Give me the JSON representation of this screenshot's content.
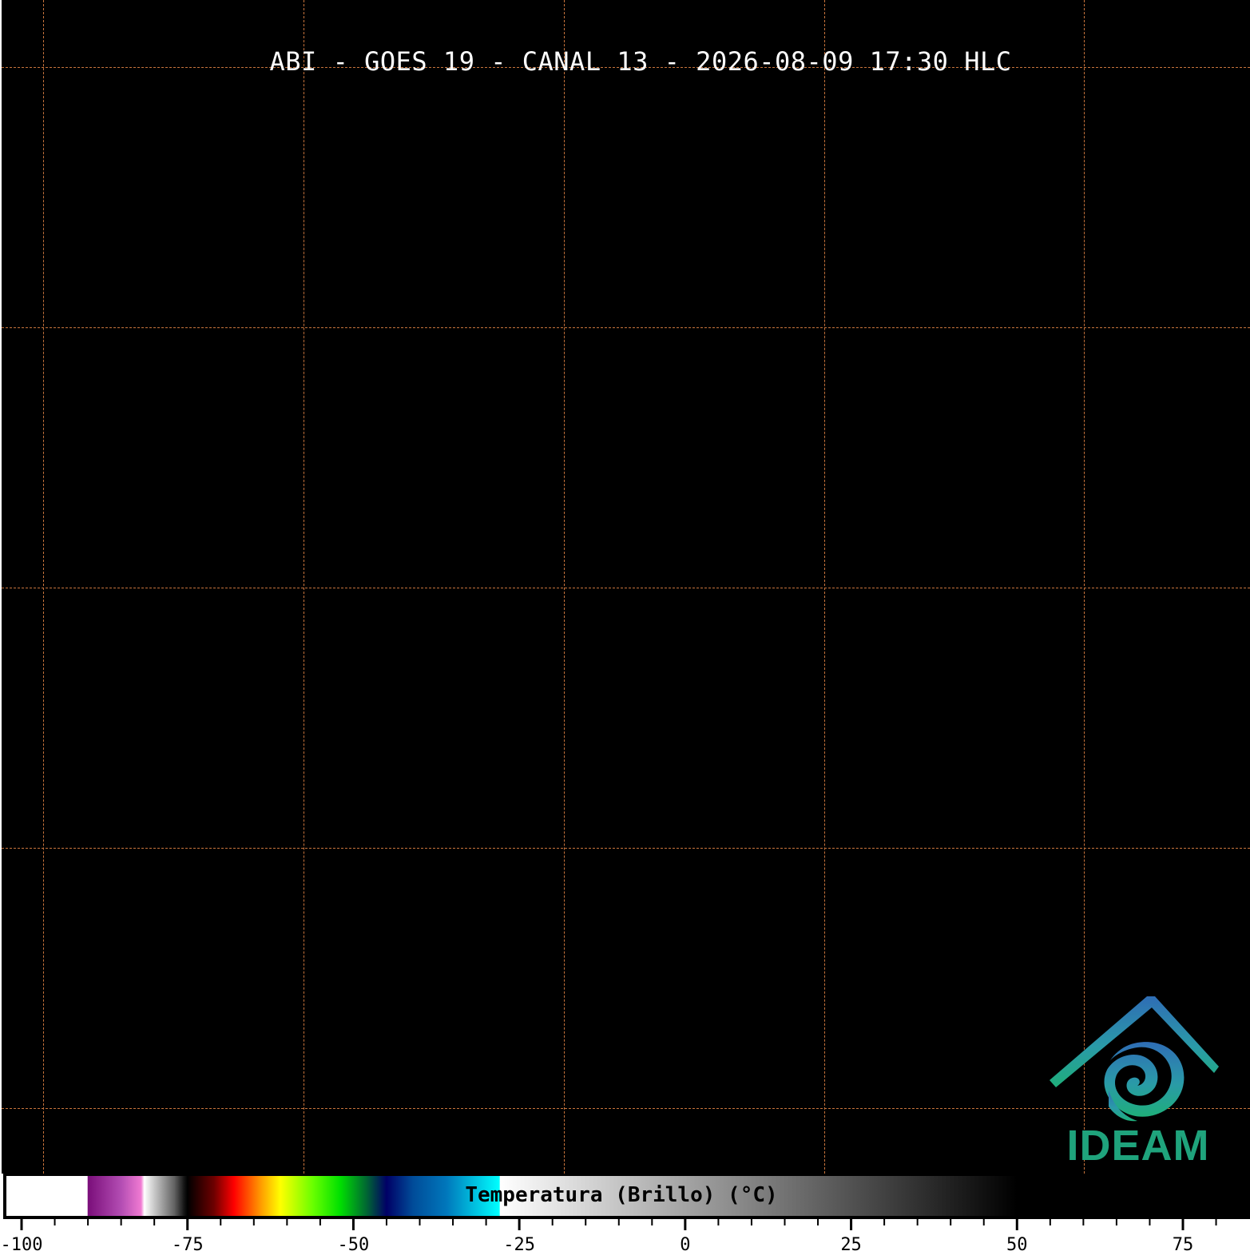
{
  "title": "ABI - GOES 19 - CANAL 13 - 2026-08-09 17:30 HLC",
  "logo": {
    "text": "IDEAM",
    "icon": "ideam-swirl-logo",
    "color": "#1fa37c"
  },
  "grid_color": "#c8743c",
  "colorbar": {
    "label": "Temperatura (Brillo) (°C)",
    "range": [
      -100,
      80
    ],
    "major_ticks": [
      -100,
      -75,
      -50,
      -25,
      0,
      25,
      50,
      75
    ],
    "minor_step": 5,
    "tick_labels": [
      "-100",
      "-75",
      "-50",
      "-25",
      "0",
      "25",
      "50",
      "75"
    ],
    "stops": [
      {
        "v": -100,
        "c": "#ffffff"
      },
      {
        "v": -90.1,
        "c": "#ffffff"
      },
      {
        "v": -90,
        "c": "#7a0e7a"
      },
      {
        "v": -85,
        "c": "#b34db3"
      },
      {
        "v": -82,
        "c": "#f07ad2"
      },
      {
        "v": -81.5,
        "c": "#ffffff"
      },
      {
        "v": -80,
        "c": "#c8c8c8"
      },
      {
        "v": -77,
        "c": "#646464"
      },
      {
        "v": -75.5,
        "c": "#141414"
      },
      {
        "v": -75,
        "c": "#000000"
      },
      {
        "v": -71,
        "c": "#6e0000"
      },
      {
        "v": -68,
        "c": "#ff0000"
      },
      {
        "v": -64,
        "c": "#ff9900"
      },
      {
        "v": -61,
        "c": "#ffff00"
      },
      {
        "v": -56,
        "c": "#66ff00"
      },
      {
        "v": -52,
        "c": "#00e000"
      },
      {
        "v": -48,
        "c": "#006633"
      },
      {
        "v": -45,
        "c": "#000066"
      },
      {
        "v": -41,
        "c": "#004c99"
      },
      {
        "v": -36,
        "c": "#0077bb"
      },
      {
        "v": -28,
        "c": "#00ffff"
      },
      {
        "v": -27.9,
        "c": "#ffffff"
      },
      {
        "v": 50,
        "c": "#000000"
      },
      {
        "v": 80,
        "c": "#000000"
      }
    ]
  }
}
